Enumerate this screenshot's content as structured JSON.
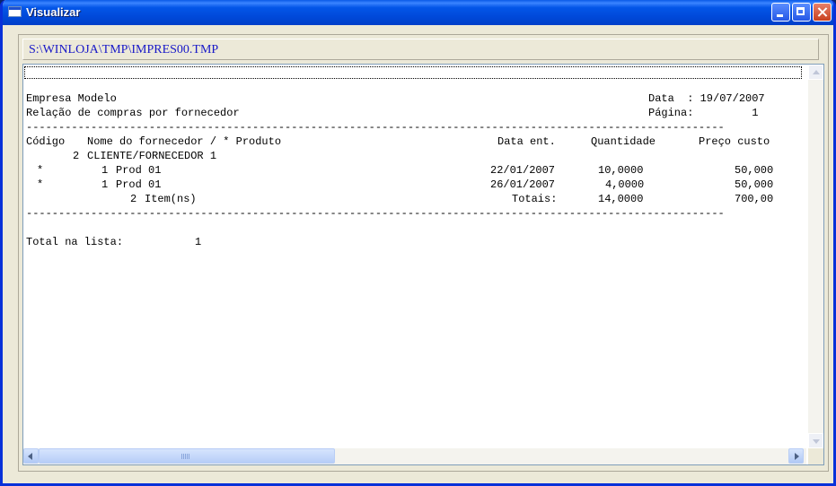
{
  "window": {
    "title": "Visualizar",
    "icons": {
      "app": "window-icon",
      "minimize": "minimize-icon",
      "maximize": "maximize-icon",
      "close": "close-icon"
    }
  },
  "path": "S:\\WINLOJA\\TMP\\IMPRES00.TMP",
  "report": {
    "company": "Empresa Modelo",
    "date_line": "Data  : 19/07/2007",
    "report_title": "Relação de compras por fornecedor",
    "page_line": "Página:         1",
    "separator": "------------------------------------------------------------------------------------------------------------",
    "columns": {
      "code": "Código",
      "name": "Nome do fornecedor / * Produto",
      "date": "Data ent.",
      "quantity": "Quantidade",
      "cost": "Preço custo"
    },
    "supplier": {
      "code": "2",
      "name": "CLIENTE/FORNECEDOR 1"
    },
    "items": [
      {
        "mark": "*",
        "code": "1",
        "product": "Prod 01",
        "date": "22/01/2007",
        "quantity": "10,0000",
        "cost": "50,000"
      },
      {
        "mark": "*",
        "code": "1",
        "product": "Prod 01",
        "date": "26/01/2007",
        "quantity": "4,0000",
        "cost": "50,000"
      }
    ],
    "subtotal": {
      "count": "2",
      "label": "Item(ns)",
      "totals_label": "Totais:",
      "quantity": "14,0000",
      "cost": "700,00"
    },
    "total_label": "Total na lista:",
    "total_value": "1"
  },
  "scrollbars": {
    "vertical": {
      "up": "arrow-up-icon",
      "down": "arrow-down-icon"
    },
    "horizontal": {
      "left": "arrow-left-icon",
      "right": "arrow-right-icon"
    }
  }
}
